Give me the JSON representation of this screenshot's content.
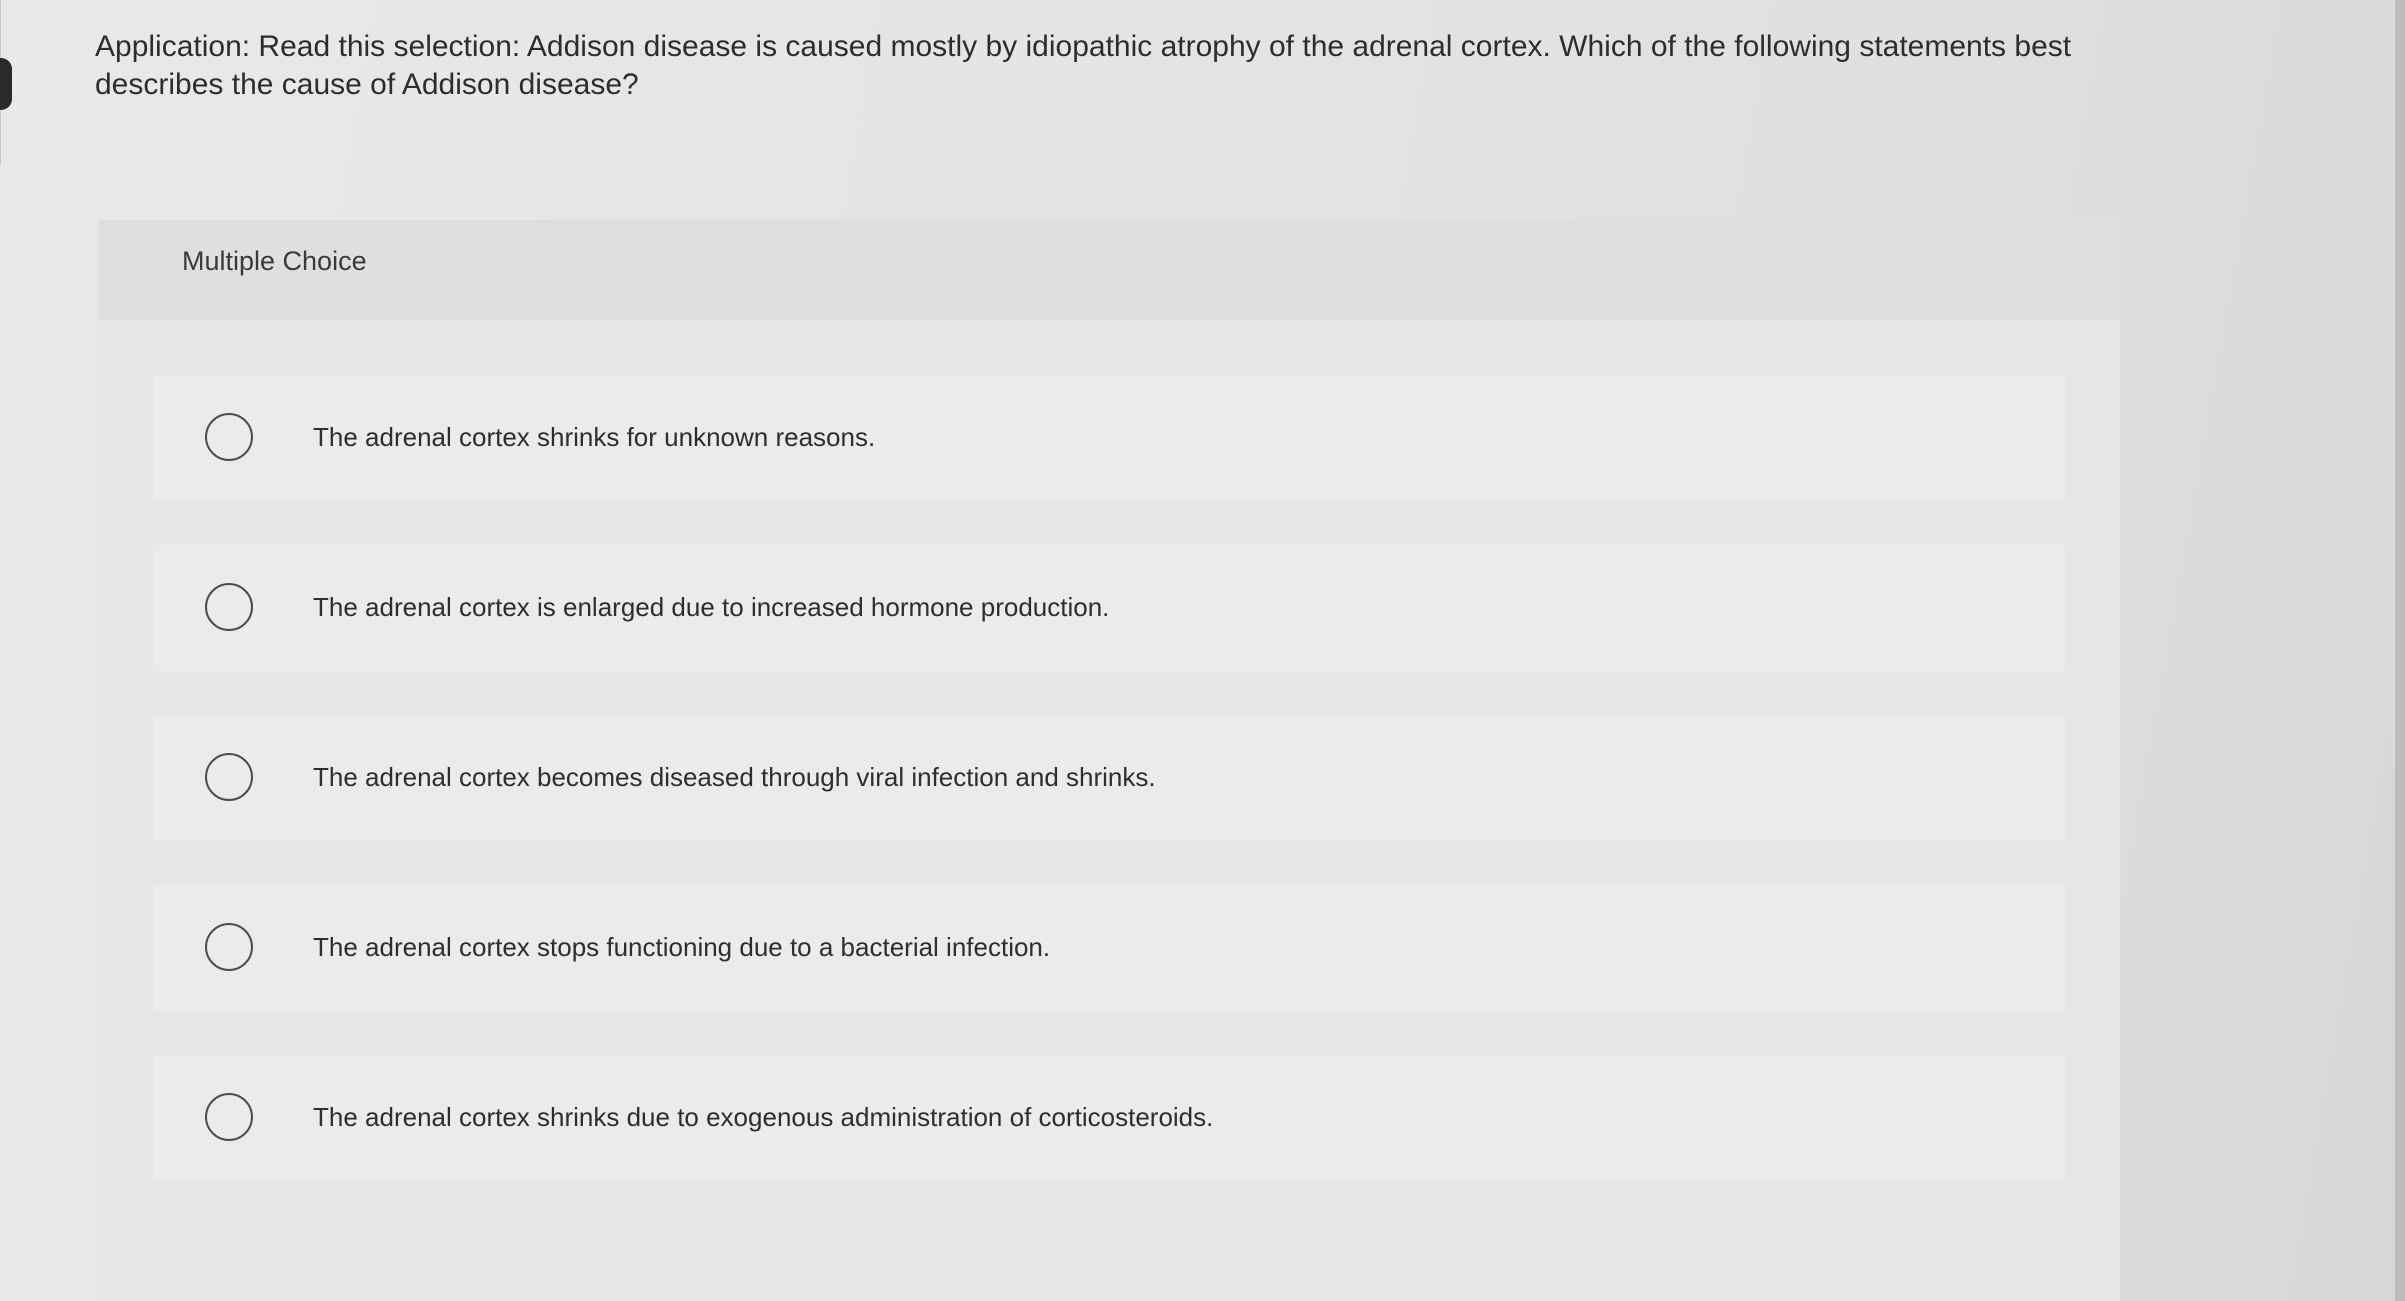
{
  "question": {
    "text": "Application: Read this selection: Addison disease is caused mostly by idiopathic atrophy of the adrenal cortex. Which of the following statements best describes the cause of Addison disease?"
  },
  "multiple_choice": {
    "title": "Multiple Choice",
    "options": [
      {
        "label": "The adrenal cortex shrinks for unknown reasons.",
        "selected": false
      },
      {
        "label": "The adrenal cortex is enlarged due to increased hormone production.",
        "selected": false
      },
      {
        "label": "The adrenal cortex becomes diseased through viral infection and shrinks.",
        "selected": false
      },
      {
        "label": "The adrenal cortex stops functioning due to a bacterial infection.",
        "selected": false
      },
      {
        "label": "The adrenal cortex shrinks due to exogenous administration of corticosteroids.",
        "selected": false
      }
    ]
  },
  "colors": {
    "background": "#e6e6e4",
    "panel": "#e6e7e5",
    "panel_header": "#dfe0de",
    "option_row": "#ebebea",
    "radio_border": "#4d4d4d",
    "text": "#2d2d2d"
  },
  "icons": {
    "radio": "radio-unchecked-icon"
  }
}
